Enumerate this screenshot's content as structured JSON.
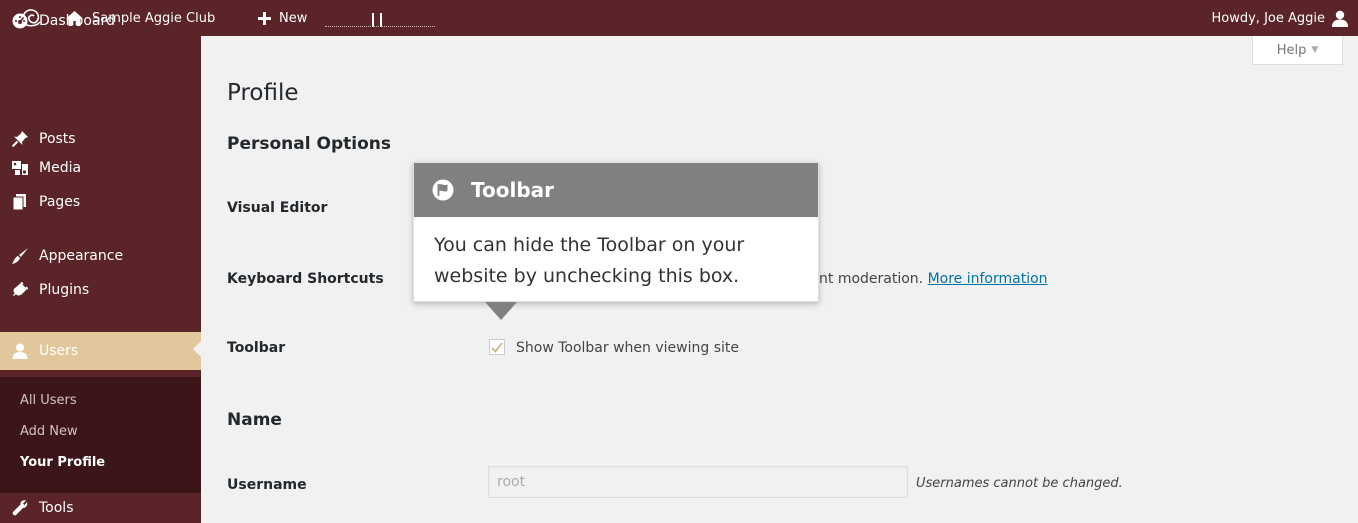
{
  "admin_bar": {
    "site_name": "Sample Aggie Club",
    "new_label": "New",
    "account_label": "Howdy, Joe Aggie"
  },
  "sidebar": {
    "items": [
      {
        "label": "Dashboard",
        "icon": "dashboard-icon"
      },
      {
        "label": "Posts",
        "icon": "pin-icon"
      },
      {
        "label": "Media",
        "icon": "media-icon"
      },
      {
        "label": "Pages",
        "icon": "pages-icon"
      },
      {
        "label": "Appearance",
        "icon": "paintbrush-icon"
      },
      {
        "label": "Plugins",
        "icon": "plug-icon"
      },
      {
        "label": "Users",
        "icon": "users-icon"
      },
      {
        "label": "Tools",
        "icon": "wrench-icon"
      }
    ],
    "submenu": [
      "All Users",
      "Add New",
      "Your Profile"
    ]
  },
  "help_tab": {
    "label": "Help",
    "caret": "▼"
  },
  "page": {
    "title": "Profile",
    "personal_options_heading": "Personal Options",
    "visual_editor_label": "Visual Editor",
    "keyboard_shortcuts_label": "Keyboard Shortcuts",
    "keyboard_shortcuts_desc": "nt moderation.",
    "more_information_link": "More information",
    "toolbar_label": "Toolbar",
    "toolbar_checkbox_label": "Show Toolbar when viewing site",
    "toolbar_checked": true,
    "name_heading": "Name",
    "username_label": "Username",
    "username_value": "root",
    "username_desc": "Usernames cannot be changed."
  },
  "pointer": {
    "title": "Toolbar",
    "body": "You can hide the Toolbar on your website by unchecking this box."
  },
  "colors": {
    "admin_bar_bg": "#5b2428",
    "sidebar_bg": "#5b2428",
    "submenu_bg": "#3c1518",
    "current_menu_bg": "#e1c79b",
    "pointer_header_bg": "#808080",
    "link": "#0073aa"
  }
}
